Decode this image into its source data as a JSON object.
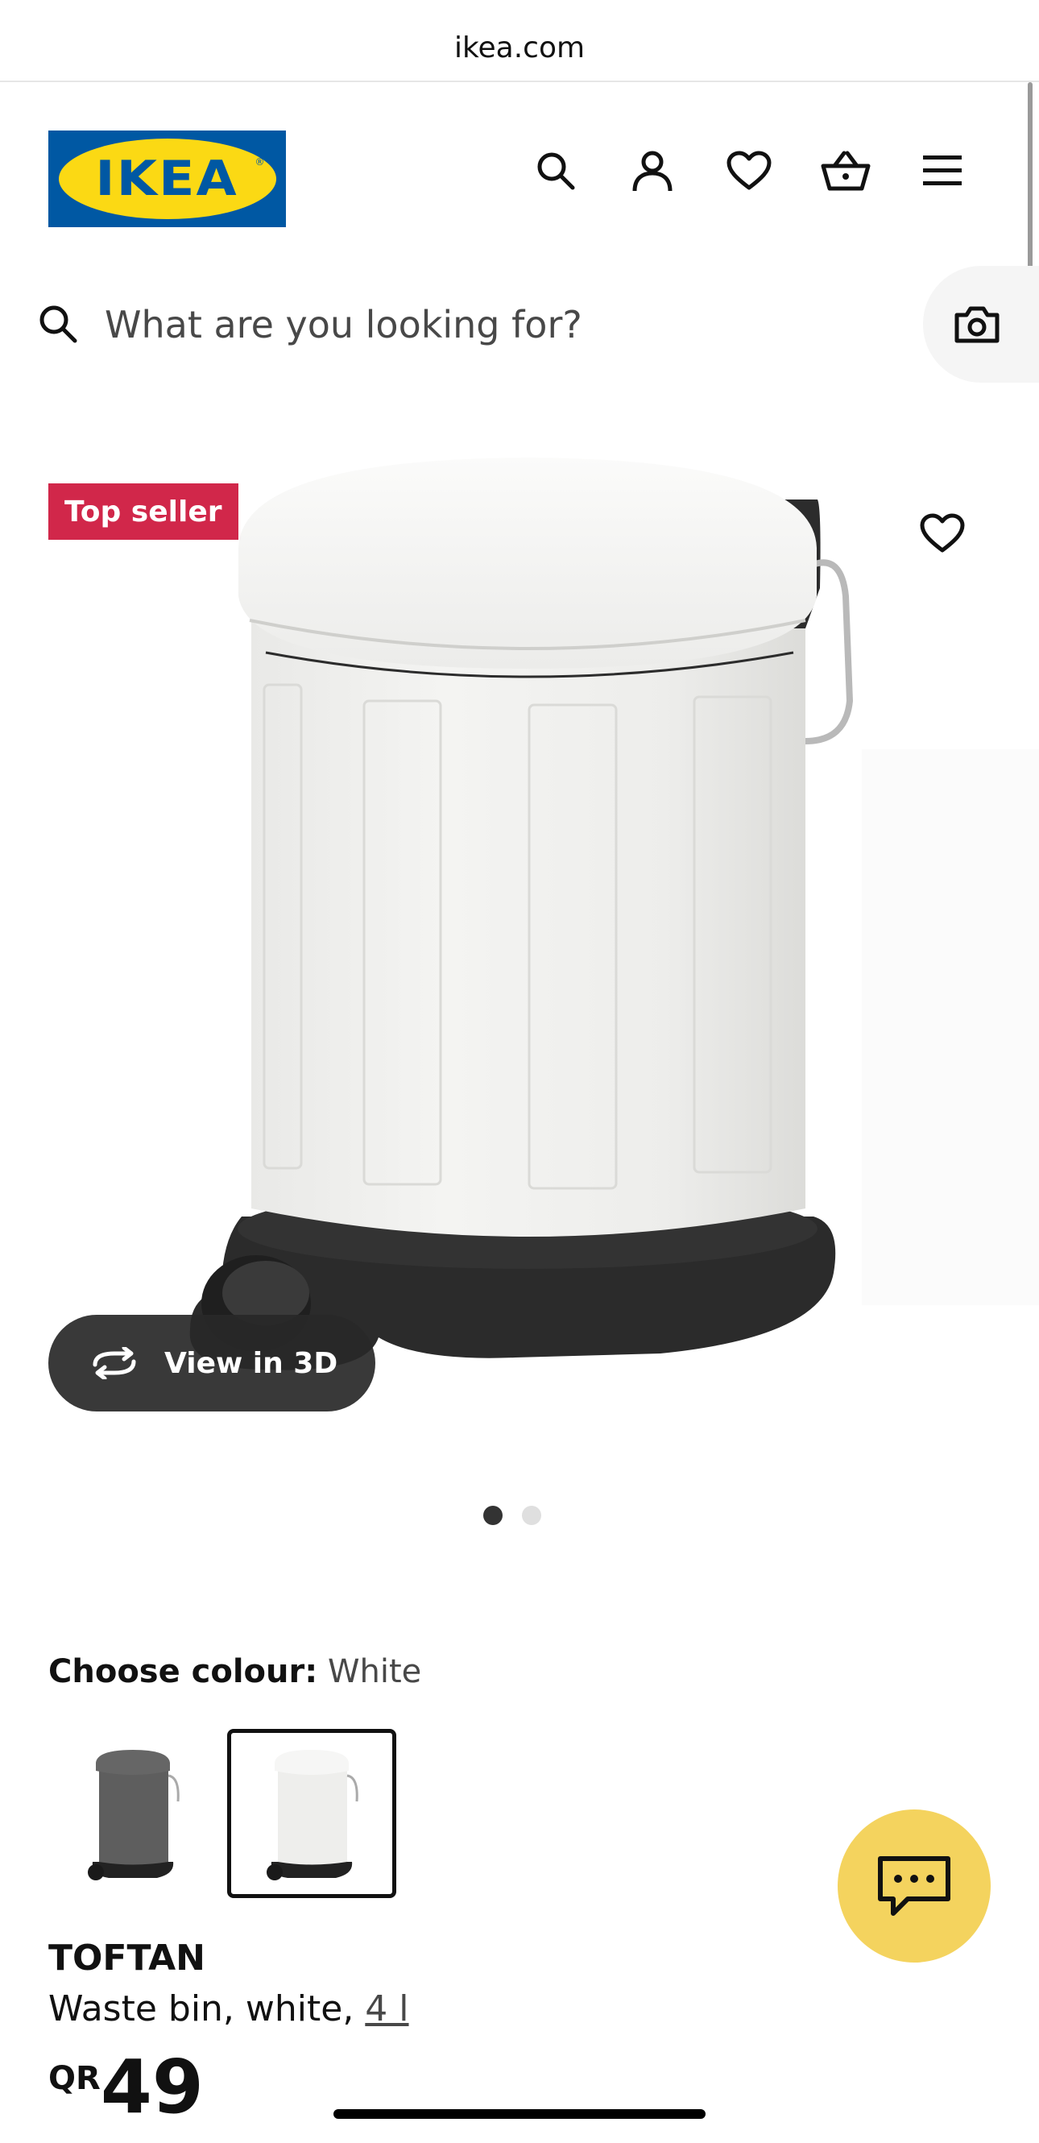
{
  "browser": {
    "url": "ikea.com"
  },
  "header": {
    "logo_text": "IKEA",
    "icons": [
      "search-icon",
      "user-icon",
      "heart-icon",
      "basket-icon",
      "menu-icon"
    ]
  },
  "search": {
    "placeholder": "What are you looking for?"
  },
  "gallery": {
    "badge": "Top seller",
    "view3d_label": "View in 3D",
    "slide_count": 2,
    "active_slide": 1
  },
  "colour": {
    "label": "Choose colour:",
    "value": "White",
    "options": [
      "Dark grey",
      "White"
    ],
    "selected_index": 1
  },
  "product": {
    "name": "TOFTAN",
    "description": "Waste bin, white, ",
    "size": "4 l",
    "currency": "QR",
    "price": "49"
  },
  "colors": {
    "ikea_blue": "#0058a3",
    "ikea_yellow": "#fbd914",
    "badge": "#d1274a",
    "chat": "#f4d35e"
  }
}
